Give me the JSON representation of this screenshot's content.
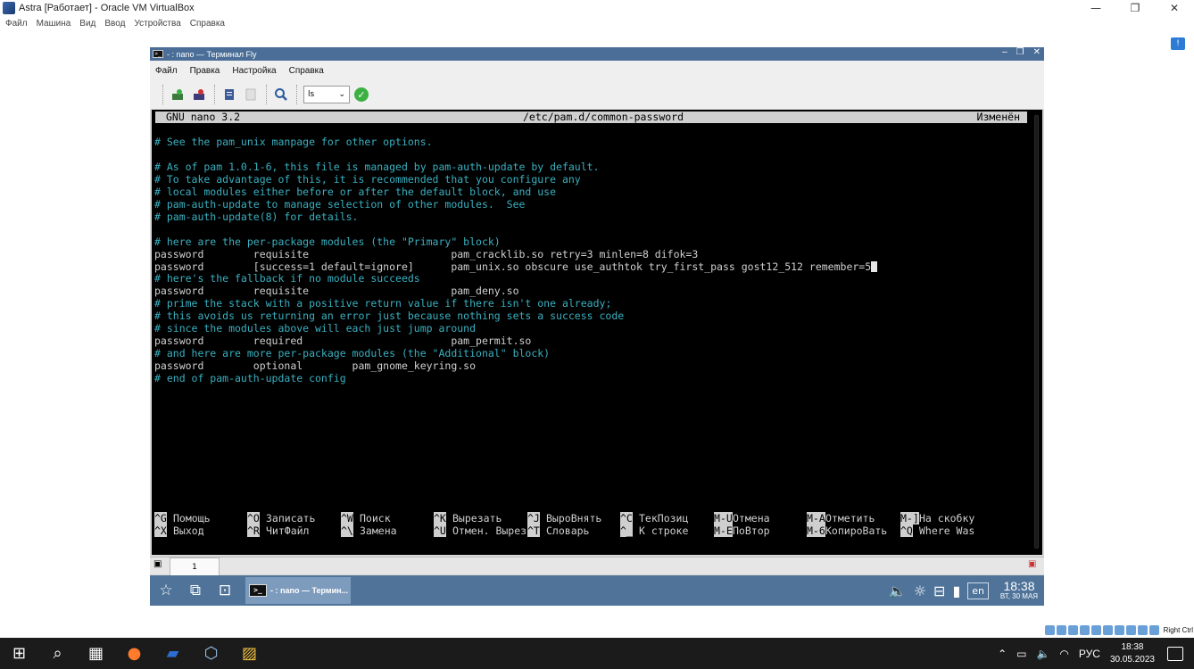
{
  "host": {
    "title": "Astra [Работает] - Oracle VM VirtualBox",
    "menu": [
      "Файл",
      "Машина",
      "Вид",
      "Ввод",
      "Устройства",
      "Справка"
    ],
    "controls": {
      "minimize": "—",
      "restore": "❐",
      "close": "✕"
    }
  },
  "fly": {
    "title": "- : nano — Терминал Fly",
    "window_controls": {
      "minimize": "–",
      "maximize": "❐",
      "close": "✕"
    },
    "menu": [
      "Файл",
      "Правка",
      "Настройка",
      "Справка"
    ],
    "toolbar": {
      "command_select": "ls",
      "icons": [
        "new-tab-icon",
        "close-tab-icon",
        "copy-icon",
        "paste-icon",
        "search-icon",
        "run-check-icon"
      ]
    }
  },
  "nano": {
    "version": "GNU nano 3.2",
    "filename": "/etc/pam.d/common-password",
    "status": "Изменён",
    "lines": [
      {
        "text": "# See the pam_unix manpage for other options.",
        "comment": true
      },
      {
        "text": "",
        "comment": false
      },
      {
        "text": "# As of pam 1.0.1-6, this file is managed by pam-auth-update by default.",
        "comment": true
      },
      {
        "text": "# To take advantage of this, it is recommended that you configure any",
        "comment": true
      },
      {
        "text": "# local modules either before or after the default block, and use",
        "comment": true
      },
      {
        "text": "# pam-auth-update to manage selection of other modules.  See",
        "comment": true
      },
      {
        "text": "# pam-auth-update(8) for details.",
        "comment": true
      },
      {
        "text": "",
        "comment": false
      },
      {
        "text": "# here are the per-package modules (the \"Primary\" block)",
        "comment": true
      },
      {
        "text": "password        requisite                       pam_cracklib.so retry=3 minlen=8 difok=3",
        "comment": false
      },
      {
        "text": "password        [success=1 default=ignore]      pam_unix.so obscure use_authtok try_first_pass gost12_512 remember=5",
        "comment": false
      },
      {
        "text": "# here's the fallback if no module succeeds",
        "comment": true
      },
      {
        "text": "password        requisite                       pam_deny.so",
        "comment": false
      },
      {
        "text": "# prime the stack with a positive return value if there isn't one already;",
        "comment": true
      },
      {
        "text": "# this avoids us returning an error just because nothing sets a success code",
        "comment": true
      },
      {
        "text": "# since the modules above will each just jump around",
        "comment": true
      },
      {
        "text": "password        required                        pam_permit.so",
        "comment": false
      },
      {
        "text": "# and here are more per-package modules (the \"Additional\" block)",
        "comment": true
      },
      {
        "text": "password        optional        pam_gnome_keyring.so",
        "comment": false
      },
      {
        "text": "# end of pam-auth-update config",
        "comment": true
      }
    ],
    "shortcuts_row1": [
      {
        "key": "^G",
        "label": "Помощь"
      },
      {
        "key": "^O",
        "label": "Записать"
      },
      {
        "key": "^W",
        "label": "Поиск"
      },
      {
        "key": "^K",
        "label": "Вырезать"
      },
      {
        "key": "^J",
        "label": "ВыроВнять"
      },
      {
        "key": "^C",
        "label": "ТекПозиц"
      },
      {
        "key": "M-U",
        "label": "Отмена"
      },
      {
        "key": "M-A",
        "label": "Отметить"
      },
      {
        "key": "M-]",
        "label": "На скобку"
      }
    ],
    "shortcuts_row2": [
      {
        "key": "^X",
        "label": "Выход"
      },
      {
        "key": "^R",
        "label": "ЧитФайл"
      },
      {
        "key": "^\\",
        "label": "Замена"
      },
      {
        "key": "^U",
        "label": "Отмен. Вырез"
      },
      {
        "key": "^T",
        "label": "Словарь"
      },
      {
        "key": "^_",
        "label": "К строке"
      },
      {
        "key": "M-E",
        "label": "ПоВтор"
      },
      {
        "key": "M-6",
        "label": "КопироВать"
      },
      {
        "key": "^Q",
        "label": "Where Was"
      }
    ]
  },
  "tabs": {
    "active_tab": "1"
  },
  "fly_panel": {
    "task_title": "- : nano — Термин...",
    "lang": "en",
    "time": "18:38",
    "date": "ВТ, 30 МАЯ"
  },
  "vbox_status": {
    "host_key": "Right Ctrl"
  },
  "win_taskbar": {
    "lang": "РУС",
    "time": "18:38",
    "date": "30.05.2023"
  }
}
